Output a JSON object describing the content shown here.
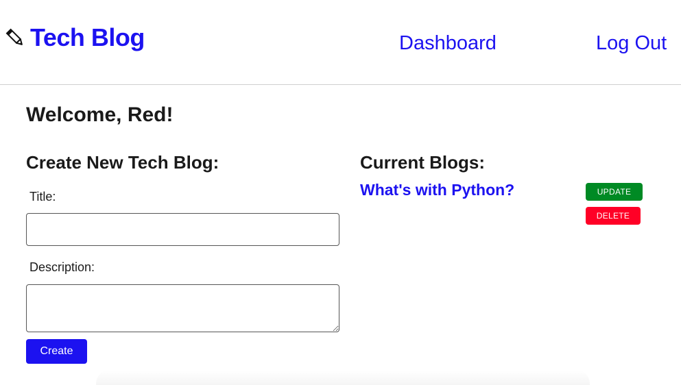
{
  "header": {
    "brand_icon": "pencil-icon",
    "brand_title": "Tech Blog",
    "nav": {
      "dashboard_label": "Dashboard",
      "logout_label": "Log Out"
    },
    "link_color": "#1c12f0"
  },
  "main": {
    "welcome": "Welcome, Red!",
    "create_form": {
      "heading": "Create New Tech Blog:",
      "title_label": "Title:",
      "title_value": "",
      "description_label": "Description:",
      "description_value": "",
      "submit_label": "Create"
    },
    "current_blogs": {
      "heading": "Current Blogs:",
      "items": [
        {
          "title": "What's with Python?",
          "update_label": "UPDATE",
          "delete_label": "DELETE"
        }
      ]
    }
  },
  "colors": {
    "primary": "#1c12f0",
    "update": "#008a24",
    "delete": "#ff0026"
  }
}
